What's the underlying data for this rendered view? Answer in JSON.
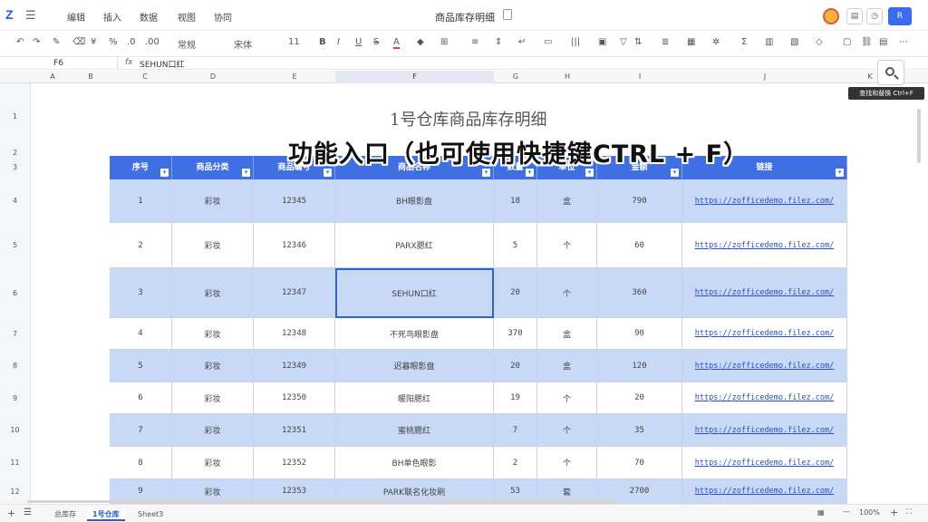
{
  "app": {
    "logo": "Z",
    "menus": [
      "编辑",
      "插入",
      "数据",
      "视图",
      "协同"
    ],
    "doc_title": "商品库存明细",
    "share_label": "R"
  },
  "toolbar": {
    "style": "常规",
    "font": "宋体",
    "size": "11",
    "items": [
      "B",
      "I",
      "U",
      "S",
      "A",
      "Σ"
    ]
  },
  "formula_bar": {
    "cell_ref": "F6",
    "fx": "fx",
    "value": "SEHUN口红"
  },
  "columns": [
    "A",
    "B",
    "C",
    "D",
    "E",
    "F",
    "G",
    "H",
    "I",
    "J",
    "K"
  ],
  "rows": [
    "1",
    "2",
    "3",
    "4",
    "5",
    "6",
    "7",
    "8",
    "9",
    "10",
    "11",
    "12"
  ],
  "sheet": {
    "title": "1号仓库商品库存明细",
    "headers": [
      "序号",
      "商品分类",
      "商品编号",
      "商品名称",
      "数量",
      "单位",
      "金额",
      "链接"
    ],
    "data": [
      {
        "no": "1",
        "cat": "彩妆",
        "code": "12345",
        "name": "BH眼影盘",
        "qty": "18",
        "unit": "盒",
        "amt": "790",
        "link": "https://zofficedemo.filez.com/"
      },
      {
        "no": "2",
        "cat": "彩妆",
        "code": "12346",
        "name": "PARX腮红",
        "qty": "5",
        "unit": "个",
        "amt": "60",
        "link": "https://zofficedemo.filez.com/"
      },
      {
        "no": "3",
        "cat": "彩妆",
        "code": "12347",
        "name": "SEHUN口红",
        "qty": "20",
        "unit": "个",
        "amt": "360",
        "link": "https://zofficedemo.filez.com/"
      },
      {
        "no": "4",
        "cat": "彩妆",
        "code": "12348",
        "name": "不死鸟眼影盘",
        "qty": "370",
        "unit": "盒",
        "amt": "90",
        "link": "https://zofficedemo.filez.com/"
      },
      {
        "no": "5",
        "cat": "彩妆",
        "code": "12349",
        "name": "迟暮眼影盘",
        "qty": "20",
        "unit": "盒",
        "amt": "120",
        "link": "https://zofficedemo.filez.com/"
      },
      {
        "no": "6",
        "cat": "彩妆",
        "code": "12350",
        "name": "暖阳腮红",
        "qty": "19",
        "unit": "个",
        "amt": "20",
        "link": "https://zofficedemo.filez.com/"
      },
      {
        "no": "7",
        "cat": "彩妆",
        "code": "12351",
        "name": "蜜桃腮红",
        "qty": "7",
        "unit": "个",
        "amt": "35",
        "link": "https://zofficedemo.filez.com/"
      },
      {
        "no": "8",
        "cat": "彩妆",
        "code": "12352",
        "name": "BH单色眼影",
        "qty": "2",
        "unit": "个",
        "amt": "70",
        "link": "https://zofficedemo.filez.com/"
      },
      {
        "no": "9",
        "cat": "彩妆",
        "code": "12353",
        "name": "PARK联名化妆刷",
        "qty": "53",
        "unit": "套",
        "amt": "2700",
        "link": "https://zofficedemo.filez.com/"
      }
    ]
  },
  "overlay_caption": "功能入口（也可使用快捷键CTRL + F）",
  "search": {
    "tooltip": "查找和替换 Ctrl+F"
  },
  "bottom": {
    "tabs": [
      "总库存",
      "1号仓库",
      "Sheet3"
    ],
    "zoom": "100%"
  },
  "colors": {
    "header_blue": "#3f6fe3",
    "row_blue": "#c8d9f6",
    "accent": "#2a5bd7"
  }
}
